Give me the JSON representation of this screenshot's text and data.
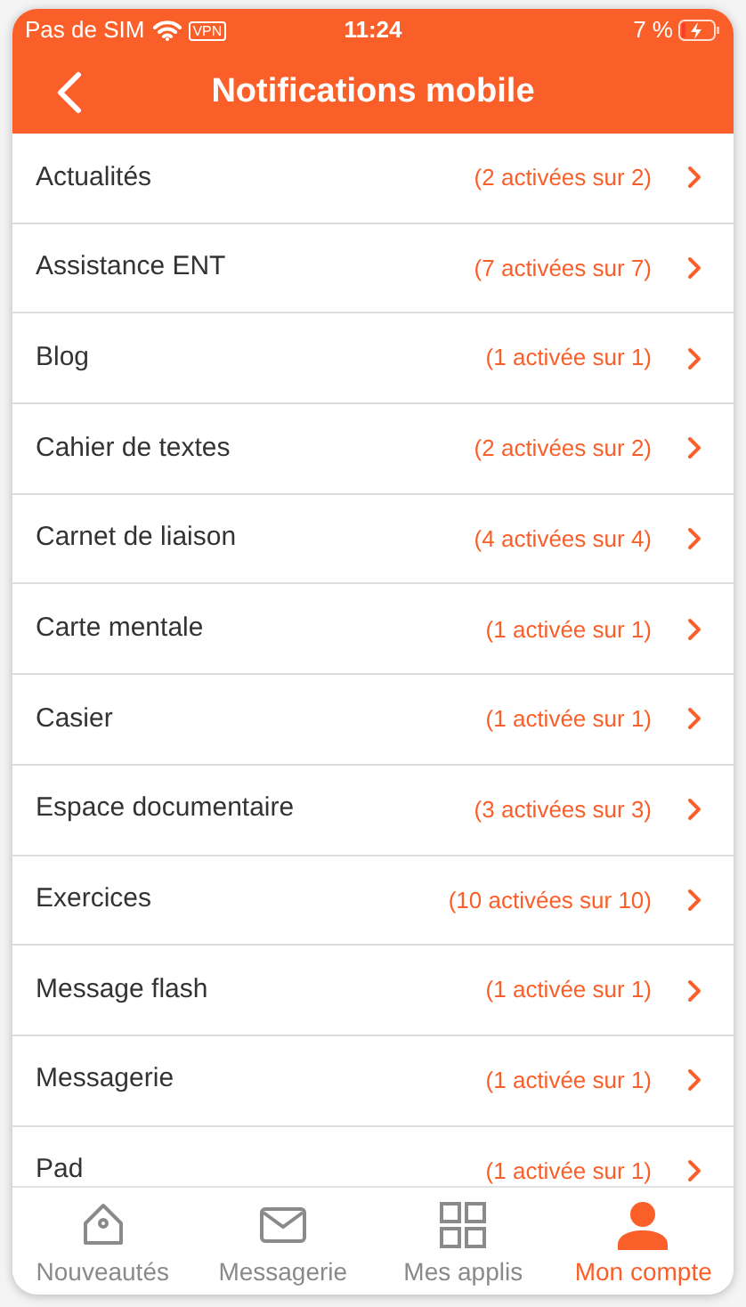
{
  "status_bar": {
    "carrier": "Pas de SIM",
    "vpn": "VPN",
    "time": "11:24",
    "battery": "7 %"
  },
  "header": {
    "title": "Notifications mobile"
  },
  "items": [
    {
      "label": "Actualités",
      "count": "(2 activées sur 2)"
    },
    {
      "label": "Assistance ENT",
      "count": "(7 activées sur 7)"
    },
    {
      "label": "Blog",
      "count": "(1 activée sur 1)"
    },
    {
      "label": "Cahier de textes",
      "count": "(2 activées sur 2)"
    },
    {
      "label": "Carnet de liaison",
      "count": "(4 activées sur 4)"
    },
    {
      "label": "Carte mentale",
      "count": "(1 activée sur 1)"
    },
    {
      "label": "Casier",
      "count": "(1 activée sur 1)"
    },
    {
      "label": "Espace documentaire",
      "count": "(3 activées sur 3)"
    },
    {
      "label": "Exercices",
      "count": "(10 activées sur 10)"
    },
    {
      "label": "Message flash",
      "count": "(1 activée sur 1)"
    },
    {
      "label": "Messagerie",
      "count": "(1 activée sur 1)"
    },
    {
      "label": "Pad",
      "count": "(1 activée sur 1)"
    }
  ],
  "tab_bar": [
    {
      "kind": "home",
      "label": "Nouveautés",
      "selected": false
    },
    {
      "kind": "mail",
      "label": "Messagerie",
      "selected": false
    },
    {
      "kind": "apps",
      "label": "Mes applis",
      "selected": false
    },
    {
      "kind": "account",
      "label": "Mon compte",
      "selected": true
    }
  ]
}
